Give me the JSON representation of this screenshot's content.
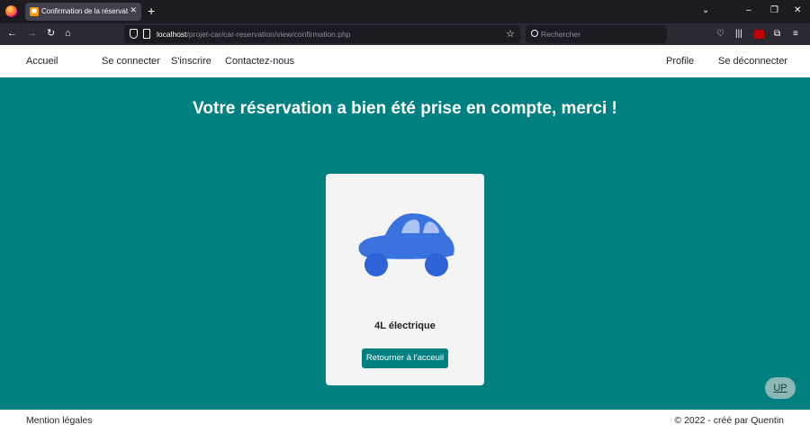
{
  "browser": {
    "tab_title": "Confirmation de la réservation",
    "tab_close": "✕",
    "new_tab": "+",
    "url_host": "localhost",
    "url_path": "/projet-car/car-reservation/view/confirmation.php",
    "search_placeholder": "Rechercher"
  },
  "header": {
    "home": "Accueil",
    "login": "Se connecter",
    "signup": "S'inscrire",
    "contact": "Contactez-nous",
    "profile": "Profile",
    "logout": "Se déconnecter"
  },
  "main": {
    "headline": "Votre réservation a bien été prise en compte, merci !",
    "car_name": "4L électrique",
    "back_button": "Retourner à l'acceuil",
    "up_button": "UP"
  },
  "footer": {
    "legal": "Mention légales",
    "copyright": "© 2022 - créé par Quentin"
  },
  "colors": {
    "teal": "#008080",
    "car_blue": "#3a73e0",
    "chrome_dark": "#1c1b22"
  }
}
